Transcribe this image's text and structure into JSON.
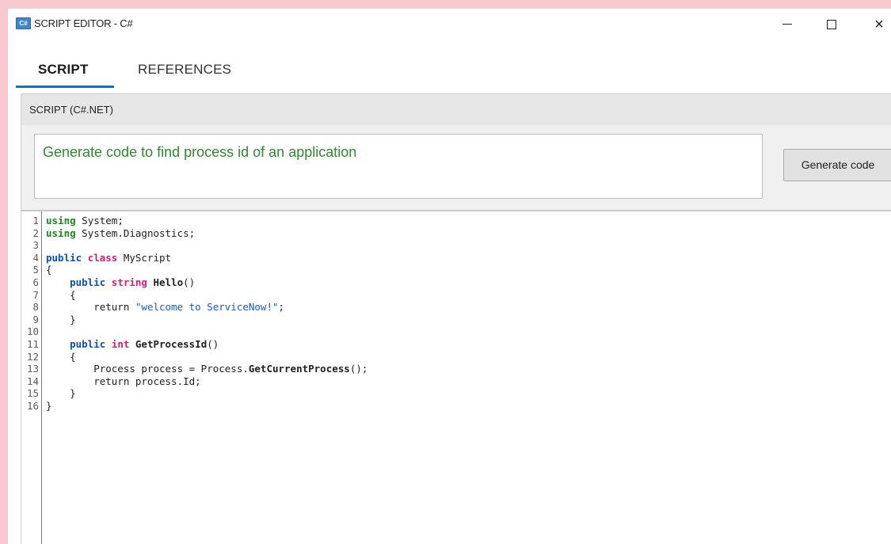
{
  "window": {
    "title": "SCRIPT EDITOR - C#",
    "icon_text": "C#"
  },
  "tabs": [
    {
      "label": "SCRIPT"
    },
    {
      "label": "REFERENCES"
    }
  ],
  "panel": {
    "header": "SCRIPT (C#.NET)",
    "prompt_text": "Generate code to find process id of an application",
    "generate_button": "Generate code"
  },
  "editor": {
    "line_numbers": [
      "1",
      "2",
      "3",
      "4",
      "5",
      "6",
      "7",
      "8",
      "9",
      "10",
      "11",
      "12",
      "13",
      "14",
      "15",
      "16"
    ],
    "lines": [
      [
        "using",
        " System;"
      ],
      [
        "using",
        " System.Diagnostics;"
      ],
      [
        ""
      ],
      [
        "public",
        " ",
        "class",
        " MyScript"
      ],
      [
        "{"
      ],
      [
        "    ",
        "public",
        " ",
        "string",
        " ",
        "Hello",
        "()"
      ],
      [
        "    {"
      ],
      [
        "        return ",
        "\"welcome to ServiceNow!\"",
        ";"
      ],
      [
        "    }"
      ],
      [
        ""
      ],
      [
        "    ",
        "public",
        " ",
        "int",
        " ",
        "GetProcessId",
        "()"
      ],
      [
        "    {"
      ],
      [
        "        Process process = Process.",
        "GetCurrentProcess",
        "();"
      ],
      [
        "        return process.Id;"
      ],
      [
        "    }"
      ],
      [
        "}"
      ]
    ]
  },
  "colors": {
    "background": "#f7c9cf",
    "accent": "#1e6fb8",
    "prompt_text": "#2d8a2d"
  }
}
